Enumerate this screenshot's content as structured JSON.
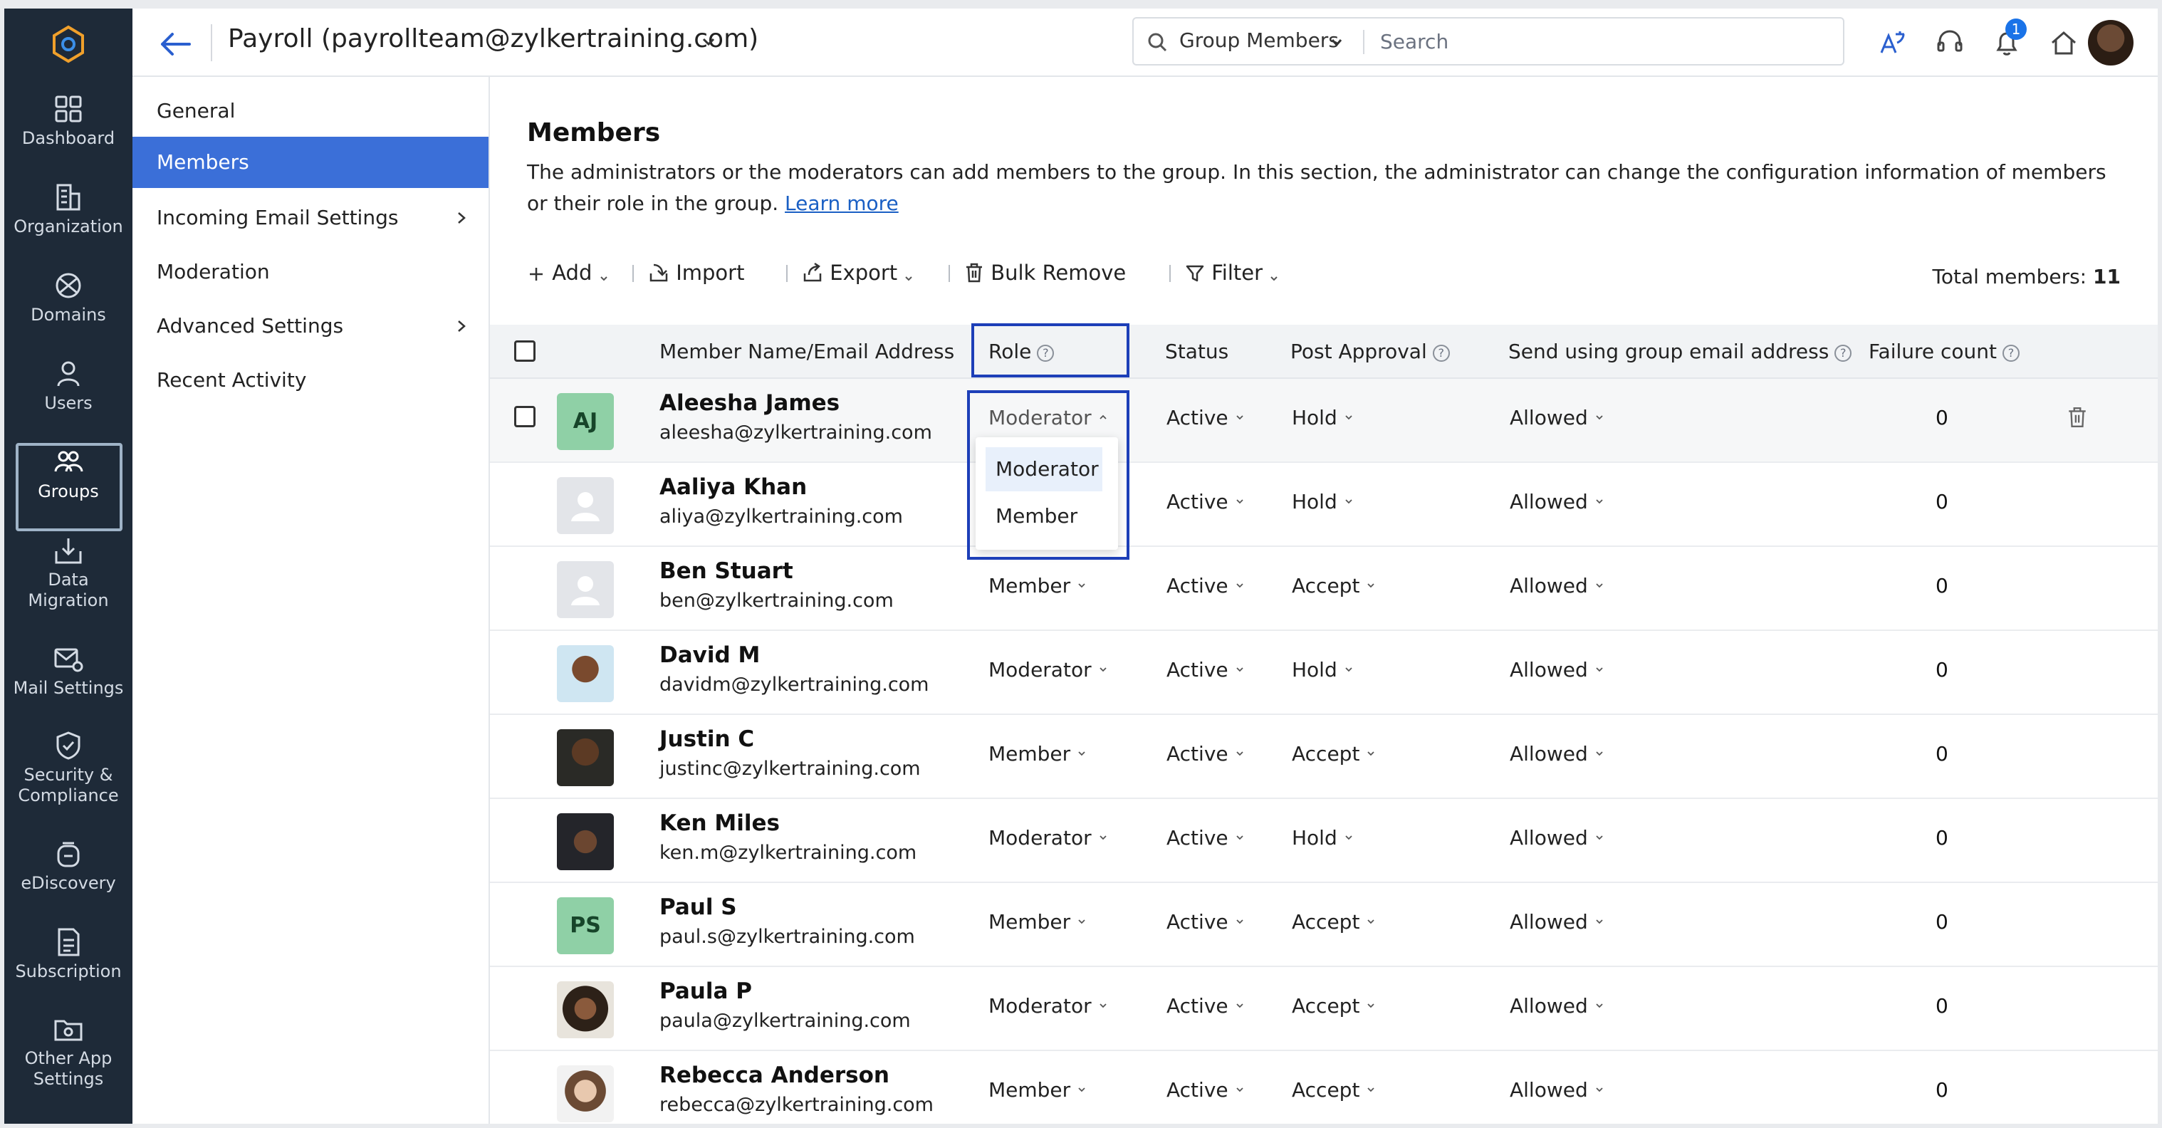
{
  "rail": {
    "items": [
      {
        "label": "Dashboard",
        "icon": "dashboard-icon"
      },
      {
        "label": "Organization",
        "icon": "organization-icon"
      },
      {
        "label": "Domains",
        "icon": "domains-icon"
      },
      {
        "label": "Users",
        "icon": "users-icon"
      },
      {
        "label": "Groups",
        "icon": "groups-icon"
      },
      {
        "label": "Data Migration",
        "icon": "data-migration-icon"
      },
      {
        "label": "Mail Settings",
        "icon": "mail-settings-icon"
      },
      {
        "label": "Security & Compliance",
        "icon": "security-icon"
      },
      {
        "label": "eDiscovery",
        "icon": "ediscovery-icon"
      },
      {
        "label": "Subscription",
        "icon": "subscription-icon"
      },
      {
        "label": "Other App Settings",
        "icon": "other-app-settings-icon"
      }
    ],
    "active": "Groups"
  },
  "header": {
    "title": "Payroll (payrollteam@zylkertraining.com)",
    "search_scope": "Group Members",
    "search_placeholder": "Search",
    "notification_count": "1"
  },
  "subnav": {
    "items": [
      {
        "label": "General"
      },
      {
        "label": "Members"
      },
      {
        "label": "Incoming Email Settings"
      },
      {
        "label": "Moderation"
      },
      {
        "label": "Advanced Settings"
      },
      {
        "label": "Recent Activity"
      }
    ],
    "active": "Members"
  },
  "main": {
    "title": "Members",
    "description": "The administrators or the moderators can add members to the group. In this section, the administrator can change the configuration information of members or their role in the group.",
    "learn_more": "Learn more",
    "toolbar": {
      "add": "Add",
      "import": "Import",
      "export": "Export",
      "bulk_remove": "Bulk Remove",
      "filter": "Filter"
    },
    "total_label": "Total members:",
    "total_count": "11",
    "columns": {
      "name": "Member Name/Email Address",
      "role": "Role",
      "status": "Status",
      "post_approval": "Post Approval",
      "send_using": "Send using group email address",
      "failure_count": "Failure count"
    },
    "role_dropdown": [
      "Moderator",
      "Member"
    ],
    "members": [
      {
        "initials": "AJ",
        "name": "Aleesha James",
        "email": "aleesha@zylkertraining.com",
        "role": "Moderator",
        "status": "Active",
        "post_approval": "Hold",
        "send": "Allowed",
        "failure": "0"
      },
      {
        "initials": "",
        "name": "Aaliya Khan",
        "email": "aliya@zylkertraining.com",
        "role": "",
        "status": "Active",
        "post_approval": "Hold",
        "send": "Allowed",
        "failure": "0"
      },
      {
        "initials": "",
        "name": "Ben Stuart",
        "email": "ben@zylkertraining.com",
        "role": "Member",
        "status": "Active",
        "post_approval": "Accept",
        "send": "Allowed",
        "failure": "0"
      },
      {
        "initials": "",
        "name": "David M",
        "email": "davidm@zylkertraining.com",
        "role": "Moderator",
        "status": "Active",
        "post_approval": "Hold",
        "send": "Allowed",
        "failure": "0"
      },
      {
        "initials": "",
        "name": "Justin C",
        "email": "justinc@zylkertraining.com",
        "role": "Member",
        "status": "Active",
        "post_approval": "Accept",
        "send": "Allowed",
        "failure": "0"
      },
      {
        "initials": "",
        "name": "Ken Miles",
        "email": "ken.m@zylkertraining.com",
        "role": "Moderator",
        "status": "Active",
        "post_approval": "Hold",
        "send": "Allowed",
        "failure": "0"
      },
      {
        "initials": "PS",
        "name": "Paul S",
        "email": "paul.s@zylkertraining.com",
        "role": "Member",
        "status": "Active",
        "post_approval": "Accept",
        "send": "Allowed",
        "failure": "0"
      },
      {
        "initials": "",
        "name": "Paula P",
        "email": "paula@zylkertraining.com",
        "role": "Moderator",
        "status": "Active",
        "post_approval": "Accept",
        "send": "Allowed",
        "failure": "0"
      },
      {
        "initials": "",
        "name": "Rebecca Anderson",
        "email": "rebecca@zylkertraining.com",
        "role": "Member",
        "status": "Active",
        "post_approval": "Accept",
        "send": "Allowed",
        "failure": "0"
      }
    ]
  },
  "colors": {
    "accent": "#3b6fd8",
    "rail_bg": "#1e2a38",
    "highlight_border": "#1d3fb8",
    "badge": "#1a73e8"
  }
}
